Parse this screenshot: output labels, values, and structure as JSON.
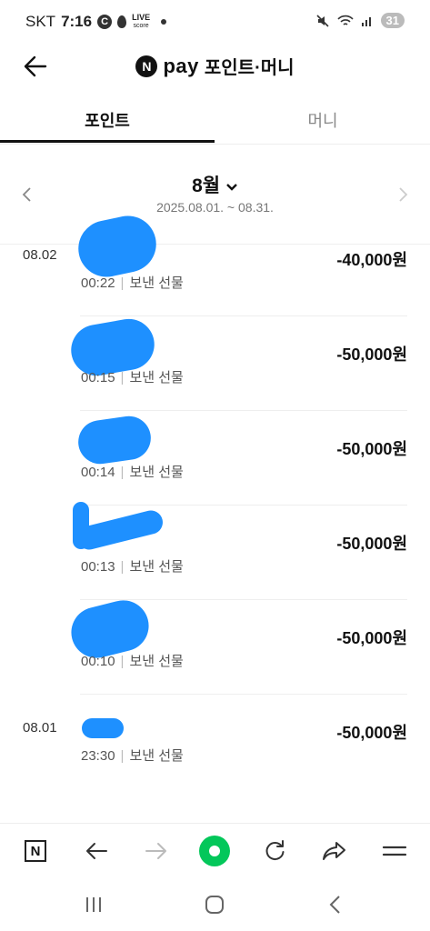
{
  "status_bar": {
    "carrier": "SKT",
    "time": "7:16",
    "badge_c": "C",
    "livescore_top": "LIVE",
    "livescore_bottom": "score",
    "battery": "31"
  },
  "header": {
    "badge": "N",
    "brand": "pay",
    "title": "포인트·머니"
  },
  "tabs": [
    {
      "label": "포인트",
      "active": true
    },
    {
      "label": "머니",
      "active": false
    }
  ],
  "month_selector": {
    "label": "8월",
    "range": "2025.08.01. ~ 08.31."
  },
  "transactions": [
    {
      "date": "08.02",
      "time": "00:22",
      "type": "보낸 선물",
      "amount": "-40,000원"
    },
    {
      "date": "",
      "time": "00:15",
      "type": "보낸 선물",
      "amount": "-50,000원"
    },
    {
      "date": "",
      "time": "00:14",
      "type": "보낸 선물",
      "amount": "-50,000원"
    },
    {
      "date": "",
      "time": "00:13",
      "type": "보낸 선물",
      "amount": "-50,000원"
    },
    {
      "date": "",
      "time": "00:10",
      "type": "보낸 선물",
      "amount": "-50,000원"
    },
    {
      "date": "08.01",
      "time": "23:30",
      "type": "보낸 선물",
      "amount": "-50,000원"
    }
  ],
  "toolbar": {
    "n_label": "N"
  },
  "colors": {
    "accent_green": "#03c75a",
    "redaction_blue": "#1e90ff"
  },
  "icons": [
    "back-arrow-icon",
    "chevron-down-icon",
    "chevron-left-icon",
    "chevron-right-icon",
    "forward-arrow-icon",
    "reload-icon",
    "share-icon",
    "menu-icon",
    "recents-icon",
    "home-icon",
    "nav-back-icon"
  ]
}
